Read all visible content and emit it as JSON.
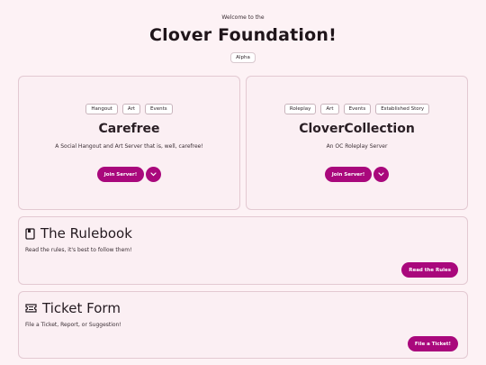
{
  "header": {
    "welcome": "Welcome to the",
    "title": "Clover Foundation!",
    "badge": "Alpha"
  },
  "servers": [
    {
      "tags": [
        "Hangout",
        "Art",
        "Events"
      ],
      "name": "Carefree",
      "description": "A Social Hangout and Art Server that is, well, carefree!",
      "join_label": "Join Server!"
    },
    {
      "tags": [
        "Roleplay",
        "Art",
        "Events",
        "Established Story"
      ],
      "name": "CloverCollection",
      "description": "An OC Roleplay Server",
      "join_label": "Join Server!"
    }
  ],
  "rulebook": {
    "icon": "book-icon",
    "title": "The Rulebook",
    "description": "Read the rules, it's best to follow them!",
    "button": "Read the Rules"
  },
  "tickets": {
    "icon": "ticket-icon",
    "title": "Ticket Form",
    "description": "File a Ticket, Report, or Suggestion!",
    "button": "File a Ticket!"
  },
  "colors": {
    "background": "#fdf2f5",
    "card": "#fbeff3",
    "accent": "#a9087c"
  }
}
